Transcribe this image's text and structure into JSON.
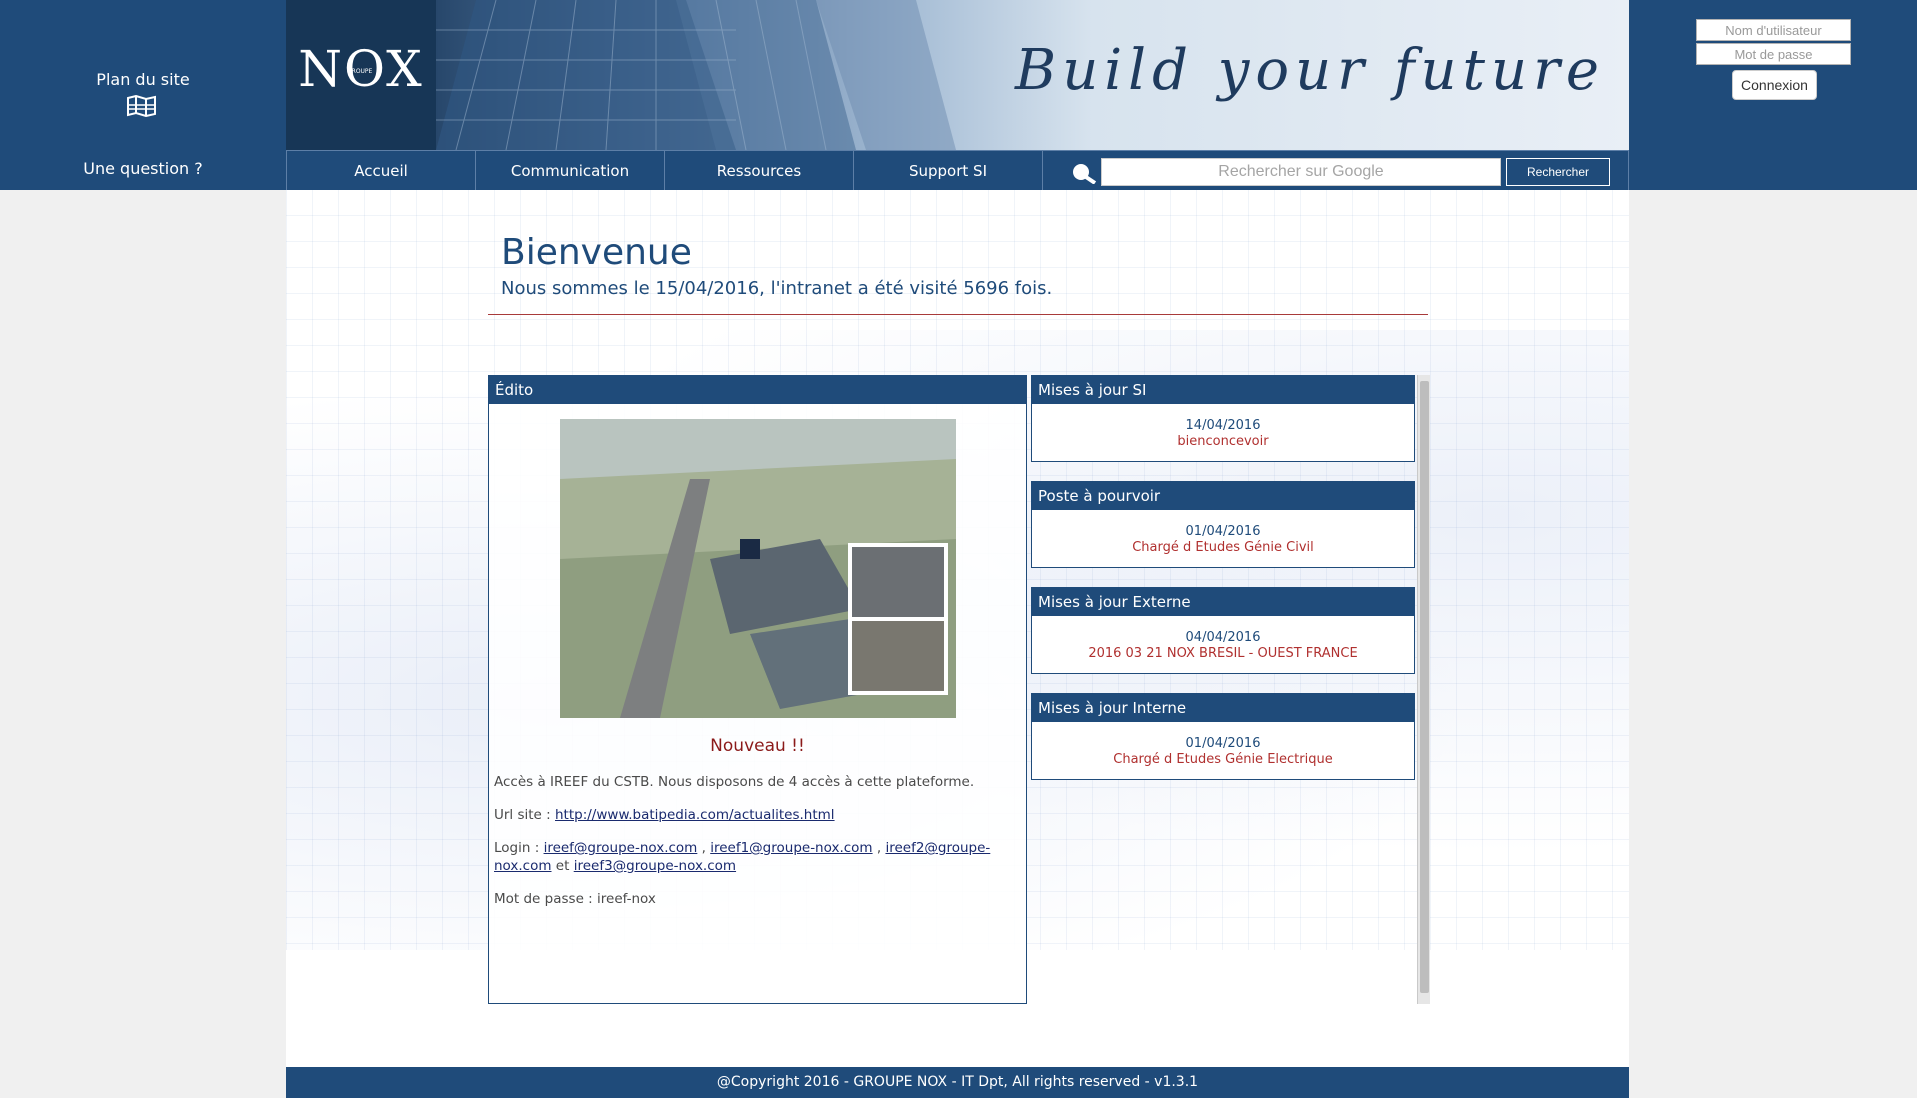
{
  "header": {
    "sitemap_label": "Plan du site",
    "question_label": "Une question ?",
    "logo_text": "NOX",
    "logo_subtext": "GROUPE",
    "tagline": "Build your future"
  },
  "login": {
    "username_placeholder": "Nom d'utilisateur",
    "password_placeholder": "Mot de passe",
    "submit_label": "Connexion"
  },
  "nav": {
    "items": [
      "Accueil",
      "Communication",
      "Ressources",
      "Support SI"
    ],
    "search_placeholder": "Rechercher sur Google",
    "search_button": "Rechercher"
  },
  "welcome": {
    "title": "Bienvenue",
    "subtitle": "Nous sommes le 15/04/2016, l'intranet a été visité 5696 fois."
  },
  "edito": {
    "header": "Édito",
    "headline": "Nouveau !!",
    "intro": "Accès à IREEF du CSTB. Nous disposons de 4 accès à cette plateforme.",
    "url_label": "Url site : ",
    "url": "http://www.batipedia.com/actualites.html",
    "login_label": "Login : ",
    "logins": [
      "ireef@groupe-nox.com",
      "ireef1@groupe-nox.com",
      "ireef2@groupe-nox.com",
      "ireef3@groupe-nox.com"
    ],
    "login_sep_comma": " , ",
    "login_sep_and": " et ",
    "password_line": "Mot de passe : ireef-nox"
  },
  "news": [
    {
      "header": "Mises à jour SI",
      "date": "14/04/2016",
      "link": "bienconcevoir"
    },
    {
      "header": "Poste à pourvoir",
      "date": "01/04/2016",
      "link": "Chargé d Etudes Génie Civil"
    },
    {
      "header": "Mises à jour Externe",
      "date": "04/04/2016",
      "link": "2016 03 21 NOX BRESIL - OUEST FRANCE"
    },
    {
      "header": "Mises à jour Interne",
      "date": "01/04/2016",
      "link": "Chargé d Etudes Génie Electrique"
    }
  ],
  "footer": {
    "copyright": "@Copyright 2016 - GROUPE NOX - IT Dpt, All rights reserved - v1.3.1"
  },
  "colors": {
    "brand_blue": "#1f4b7a",
    "accent_red": "#b0302f"
  },
  "icons": [
    "map-icon",
    "search-icon"
  ]
}
